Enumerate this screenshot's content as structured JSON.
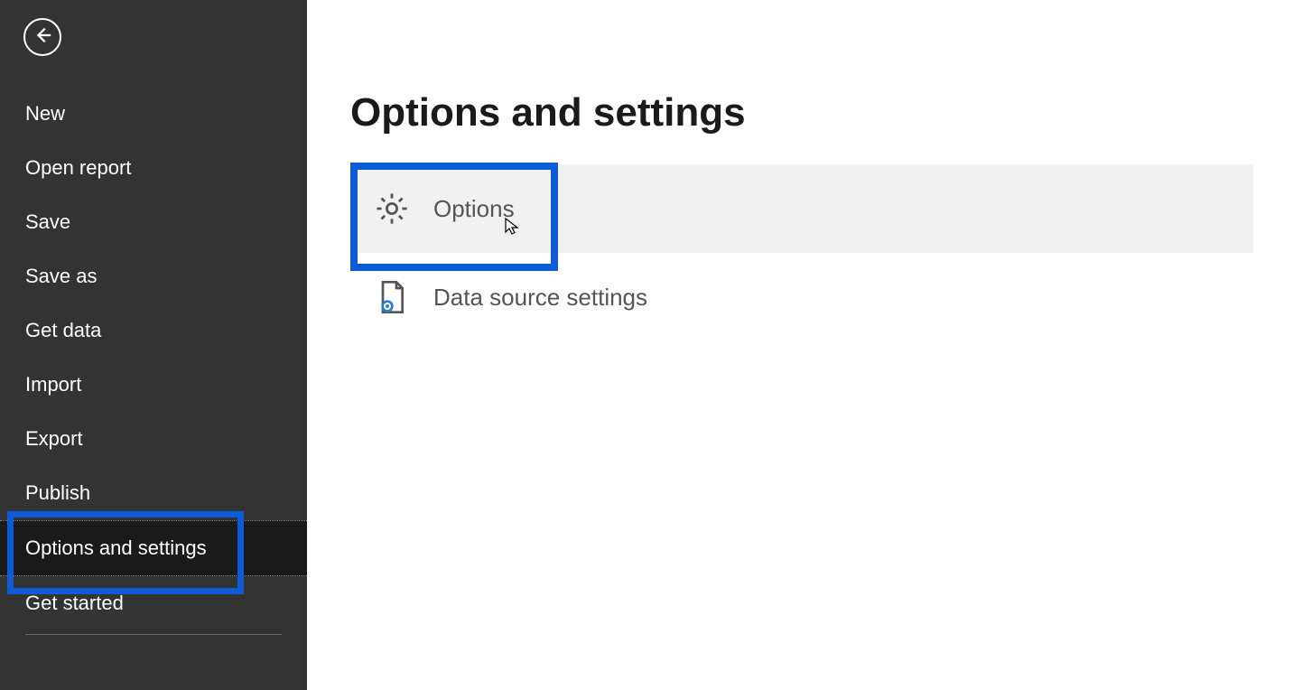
{
  "sidebar": {
    "items": [
      {
        "label": "New",
        "key": "new"
      },
      {
        "label": "Open report",
        "key": "open-report"
      },
      {
        "label": "Save",
        "key": "save"
      },
      {
        "label": "Save as",
        "key": "save-as"
      },
      {
        "label": "Get data",
        "key": "get-data"
      },
      {
        "label": "Import",
        "key": "import"
      },
      {
        "label": "Export",
        "key": "export"
      },
      {
        "label": "Publish",
        "key": "publish"
      },
      {
        "label": "Options and settings",
        "key": "options-and-settings",
        "selected": true
      },
      {
        "label": "Get started",
        "key": "get-started"
      }
    ]
  },
  "main": {
    "title": "Options and settings",
    "options": [
      {
        "label": "Options",
        "icon": "gear",
        "highlighted": true
      },
      {
        "label": "Data source settings",
        "icon": "page-gear"
      }
    ]
  },
  "colors": {
    "highlight": "#0b5cd6",
    "sidebar_bg": "#333333",
    "selected_bg": "#1a1a1a"
  }
}
